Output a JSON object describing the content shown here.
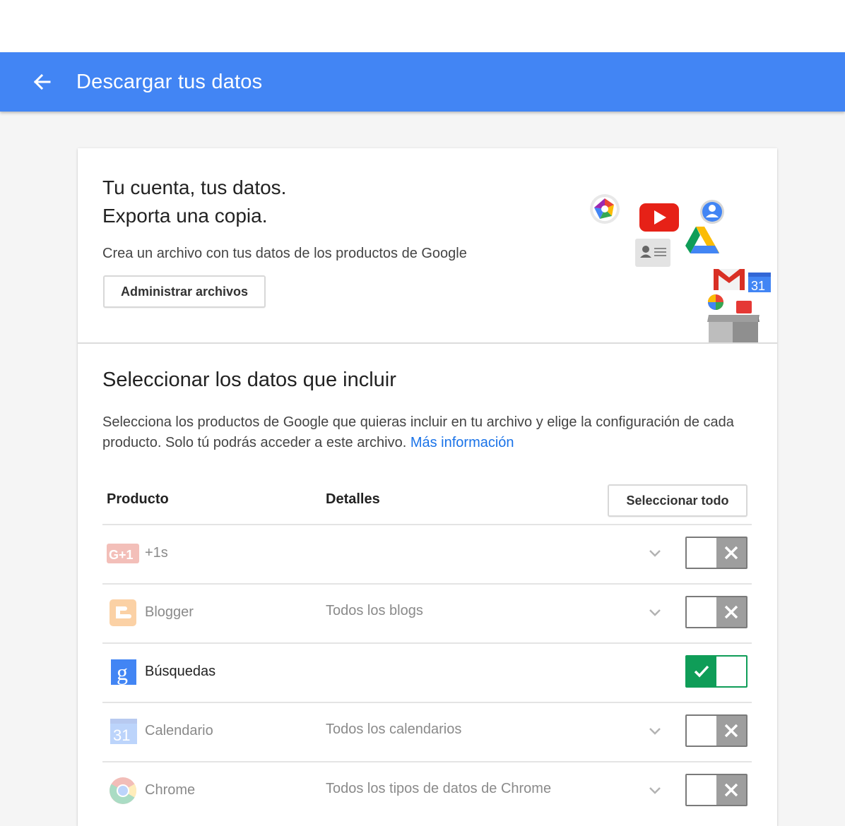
{
  "header": {
    "title": "Descargar tus datos",
    "back_icon": "arrow-back-icon"
  },
  "intro": {
    "heading_line1": "Tu cuenta, tus datos.",
    "heading_line2": "Exporta una copia.",
    "description": "Crea un archivo con tus datos de los productos de Google",
    "manage_button": "Administrar archivos",
    "illustration_icons": [
      "picasa-icon",
      "youtube-icon",
      "profile-icon",
      "contacts-icon",
      "drive-icon",
      "calendar-icon",
      "gmail-icon",
      "hangouts-icon",
      "box-icon"
    ],
    "calendar_badge": "31"
  },
  "select": {
    "title": "Seleccionar los datos que incluir",
    "description": "Selecciona los productos de Google que quieras incluir en tu archivo y elige la configuración de cada producto. Solo tú podrás acceder a este archivo.",
    "more_link": "Más información",
    "col_product": "Producto",
    "col_details": "Detalles",
    "select_all": "Seleccionar todo"
  },
  "products": [
    {
      "name": "+1s",
      "details": "",
      "icon": "google-plus-one-icon",
      "icon_text": "G+1",
      "enabled": false,
      "expandable": true
    },
    {
      "name": "Blogger",
      "details": "Todos los blogs",
      "icon": "blogger-icon",
      "enabled": false,
      "expandable": true
    },
    {
      "name": "Búsquedas",
      "details": "",
      "icon": "google-search-icon",
      "icon_text": "g",
      "enabled": true,
      "expandable": false
    },
    {
      "name": "Calendario",
      "details": "Todos los calendarios",
      "icon": "calendar-icon",
      "icon_text": "31",
      "enabled": false,
      "expandable": true
    },
    {
      "name": "Chrome",
      "details": "Todos los tipos de datos de Chrome",
      "icon": "chrome-icon",
      "enabled": false,
      "expandable": true
    }
  ],
  "colors": {
    "app_bar": "#4285f4",
    "toggle_on": "#0f9d58",
    "toggle_off": "#9e9e9e",
    "link": "#1a73e8"
  }
}
